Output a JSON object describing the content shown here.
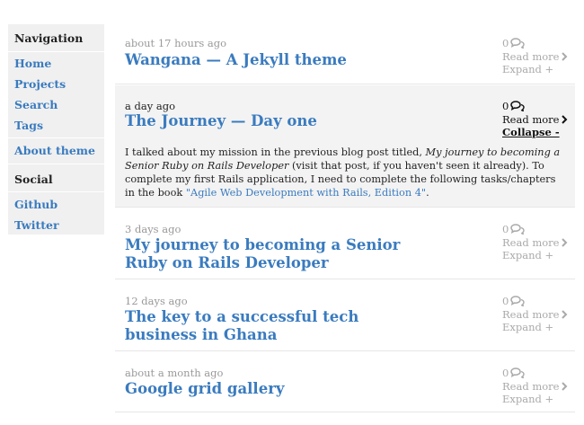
{
  "sidebar": {
    "navigation_title": "Navigation",
    "nav_items": [
      {
        "label": "Home"
      },
      {
        "label": "Projects"
      },
      {
        "label": "Search"
      },
      {
        "label": "Tags"
      }
    ],
    "about_label": "About theme",
    "social_title": "Social",
    "social_items": [
      {
        "label": "Github"
      },
      {
        "label": "Twitter"
      }
    ]
  },
  "posts": [
    {
      "time": "about 17 hours ago",
      "title": "Wangana — A Jekyll theme",
      "comments": "0",
      "read_more": "Read more",
      "toggle": "Expand +"
    },
    {
      "time": "a day ago",
      "title": "The Journey — Day one",
      "comments": "0",
      "read_more": "Read more",
      "toggle": "Collapse -",
      "body": {
        "intro": "I talked about my mission in the previous blog post titled, ",
        "italic": "My journey to becoming a Senior Ruby on Rails Developer",
        "middle": " (visit that post, if you haven't seen it already). To complete my first Rails application, I need to complete the following tasks/chapters in the book ",
        "link": "\"Agile Web Development with Rails, Edition 4\"",
        "end": "."
      }
    },
    {
      "time": "3 days ago",
      "title": "My journey to becoming a Senior Ruby on Rails Developer",
      "comments": "0",
      "read_more": "Read more",
      "toggle": "Expand +"
    },
    {
      "time": "12 days ago",
      "title": "The key to a successful tech business in Ghana",
      "comments": "0",
      "read_more": "Read more",
      "toggle": "Expand +"
    },
    {
      "time": "about a month ago",
      "title": "Google grid gallery",
      "comments": "0",
      "read_more": "Read more",
      "toggle": "Expand +"
    }
  ],
  "icons": {
    "comment": "comment-icon",
    "chevron": "chevron-right-icon"
  },
  "colors": {
    "link": "#3a7bbf",
    "sidebar_bg": "#f0f0f0",
    "expanded_bg": "#f3f3f3",
    "muted": "#999999"
  }
}
